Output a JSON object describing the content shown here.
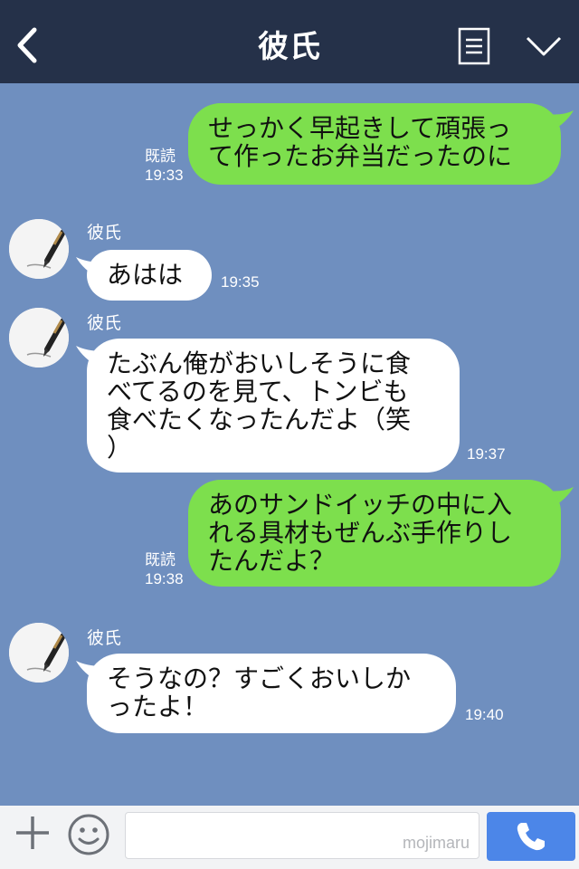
{
  "header": {
    "title": "彼氏"
  },
  "messages": [
    {
      "side": "out",
      "text": "せっかく早起きして頑張っ\nて作ったお弁当だったのに",
      "read": "既読",
      "time": "19:33"
    },
    {
      "side": "in",
      "sender": "彼氏",
      "text": "あはは",
      "time": "19:35"
    },
    {
      "side": "in",
      "sender": "彼氏",
      "text": "たぶん俺がおいしそうに食\nべてるのを見て、トンビも\n食べたくなったんだよ（笑\n）",
      "time": "19:37"
    },
    {
      "side": "out",
      "text": "あのサンドイッチの中に入\nれる具材もぜんぶ手作りし\nたんだよ？",
      "read": "既読",
      "time": "19:38"
    },
    {
      "side": "in",
      "sender": "彼氏",
      "text": "そうなの？すごくおいしか\nったよ！",
      "time": "19:40"
    }
  ],
  "composer": {
    "watermark": "mojimaru"
  },
  "icons": [
    "back-icon",
    "menu-icon",
    "chevron-down-icon",
    "plus-icon",
    "smile-icon",
    "phone-icon",
    "avatar-pen-icon"
  ],
  "colors": {
    "header": "#253149",
    "background": "#6f8fbf",
    "out_bubble": "#7ddf4d",
    "in_bubble": "#ffffff",
    "send": "#4c86e8"
  }
}
